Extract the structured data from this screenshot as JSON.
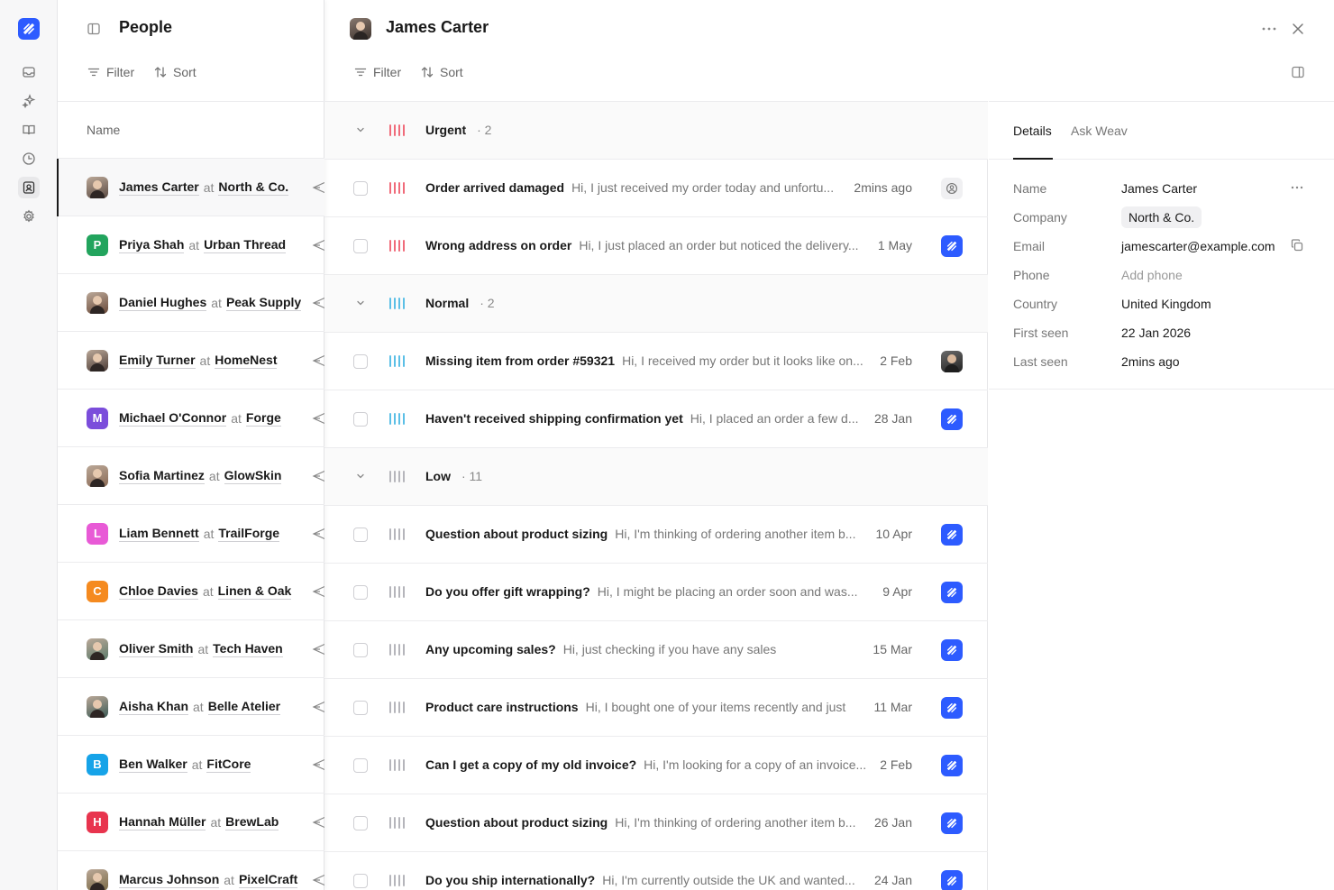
{
  "colors": {
    "accent": "#2d5bff",
    "urgent": "#f06b7a",
    "normal": "#5bbfe6",
    "low": "#b5b5bb"
  },
  "sidebar": {
    "icons": [
      "app-logo",
      "inbox-icon",
      "sparkle-icon",
      "book-icon",
      "clock-icon",
      "contacts-icon",
      "gear-icon"
    ]
  },
  "people_panel": {
    "title": "People",
    "filter_label": "Filter",
    "sort_label": "Sort",
    "column_name": "Name",
    "at_word": "at",
    "people": [
      {
        "name": "James Carter",
        "company": "North & Co.",
        "avatar": "photo",
        "color": "#5a4a42",
        "selected": true
      },
      {
        "name": "Priya Shah",
        "company": "Urban Thread",
        "avatar": "P",
        "color": "#22a45d"
      },
      {
        "name": "Daniel Hughes",
        "company": "Peak Supply",
        "avatar": "photo",
        "color": "#6a4a3a"
      },
      {
        "name": "Emily Turner",
        "company": "HomeNest",
        "avatar": "photo",
        "color": "#4a3a35"
      },
      {
        "name": "Michael O'Connor",
        "company": "Forge",
        "avatar": "M",
        "color": "#7b4ddb"
      },
      {
        "name": "Sofia Martinez",
        "company": "GlowSkin",
        "avatar": "photo",
        "color": "#8a6a55"
      },
      {
        "name": "Liam Bennett",
        "company": "TrailForge",
        "avatar": "L",
        "color": "#e85ad6"
      },
      {
        "name": "Chloe Davies",
        "company": "Linen & Oak",
        "avatar": "C",
        "color": "#f58a1f"
      },
      {
        "name": "Oliver Smith",
        "company": "Tech Haven",
        "avatar": "photo",
        "color": "#5a7a6a"
      },
      {
        "name": "Aisha Khan",
        "company": "Belle Atelier",
        "avatar": "photo",
        "color": "#3a5a55"
      },
      {
        "name": "Ben Walker",
        "company": "FitCore",
        "avatar": "B",
        "color": "#16a3e8"
      },
      {
        "name": "Hannah Müller",
        "company": "BrewLab",
        "avatar": "H",
        "color": "#e8344e"
      },
      {
        "name": "Marcus Johnson",
        "company": "PixelCraft",
        "avatar": "photo",
        "color": "#7a6a45"
      }
    ]
  },
  "main": {
    "title": "James Carter",
    "filter_label": "Filter",
    "sort_label": "Sort",
    "rows": [
      {
        "kind": "group",
        "label": "Urgent",
        "count": "· 2",
        "priority": "urgent"
      },
      {
        "kind": "conv",
        "title": "Order arrived damaged",
        "preview": "Hi, I just received my order today and unfortu...",
        "time": "2mins ago",
        "priority": "urgent",
        "assignee": "person-outline"
      },
      {
        "kind": "conv",
        "title": "Wrong address on order",
        "preview": "Hi, I just placed an order but noticed the delivery...",
        "time": "1 May",
        "priority": "urgent",
        "assignee": "bot"
      },
      {
        "kind": "group",
        "label": "Normal",
        "count": "· 2",
        "priority": "normal"
      },
      {
        "kind": "conv",
        "title": "Missing item from order #59321",
        "preview": "Hi, I received my order but it looks like on...",
        "time": "2 Feb",
        "priority": "normal",
        "assignee": "photo"
      },
      {
        "kind": "conv",
        "title": "Haven't received shipping confirmation yet",
        "preview": "Hi, I placed an order a few d...",
        "time": "28 Jan",
        "priority": "normal",
        "assignee": "bot"
      },
      {
        "kind": "group",
        "label": "Low",
        "count": "· 11",
        "priority": "low"
      },
      {
        "kind": "conv",
        "title": "Question about product sizing",
        "preview": "Hi, I'm thinking of ordering another item b...",
        "time": "10 Apr",
        "priority": "low",
        "assignee": "bot"
      },
      {
        "kind": "conv",
        "title": "Do you offer gift wrapping?",
        "preview": "Hi, I might be placing an order soon and was...",
        "time": "9 Apr",
        "priority": "low",
        "assignee": "bot"
      },
      {
        "kind": "conv",
        "title": "Any upcoming sales?",
        "preview": "Hi, just checking if you have any sales",
        "time": "15 Mar",
        "priority": "low",
        "assignee": "bot"
      },
      {
        "kind": "conv",
        "title": "Product care instructions",
        "preview": "Hi, I bought one of your items recently and just",
        "time": "11 Mar",
        "priority": "low",
        "assignee": "bot"
      },
      {
        "kind": "conv",
        "title": "Can I get a copy of my old invoice?",
        "preview": "Hi, I'm looking for a copy of an invoice...",
        "time": "2 Feb",
        "priority": "low",
        "assignee": "bot"
      },
      {
        "kind": "conv",
        "title": "Question about product sizing",
        "preview": "Hi, I'm thinking of ordering another item b...",
        "time": "26 Jan",
        "priority": "low",
        "assignee": "bot"
      },
      {
        "kind": "conv",
        "title": "Do you ship internationally?",
        "preview": "Hi, I'm currently outside the UK and wanted...",
        "time": "24 Jan",
        "priority": "low",
        "assignee": "bot"
      }
    ]
  },
  "details": {
    "tabs": [
      "Details",
      "Ask Weav"
    ],
    "fields": [
      {
        "label": "Name",
        "value": "James Carter",
        "style": "plain"
      },
      {
        "label": "Company",
        "value": "North & Co.",
        "style": "chip"
      },
      {
        "label": "Email",
        "value": "jamescarter@example.com",
        "style": "plain"
      },
      {
        "label": "Phone",
        "value": "Add phone",
        "style": "placeholder"
      },
      {
        "label": "Country",
        "value": "United Kingdom",
        "style": "plain"
      },
      {
        "label": "First seen",
        "value": "22 Jan 2026",
        "style": "plain"
      },
      {
        "label": "Last seen",
        "value": "2mins ago",
        "style": "plain"
      }
    ]
  }
}
